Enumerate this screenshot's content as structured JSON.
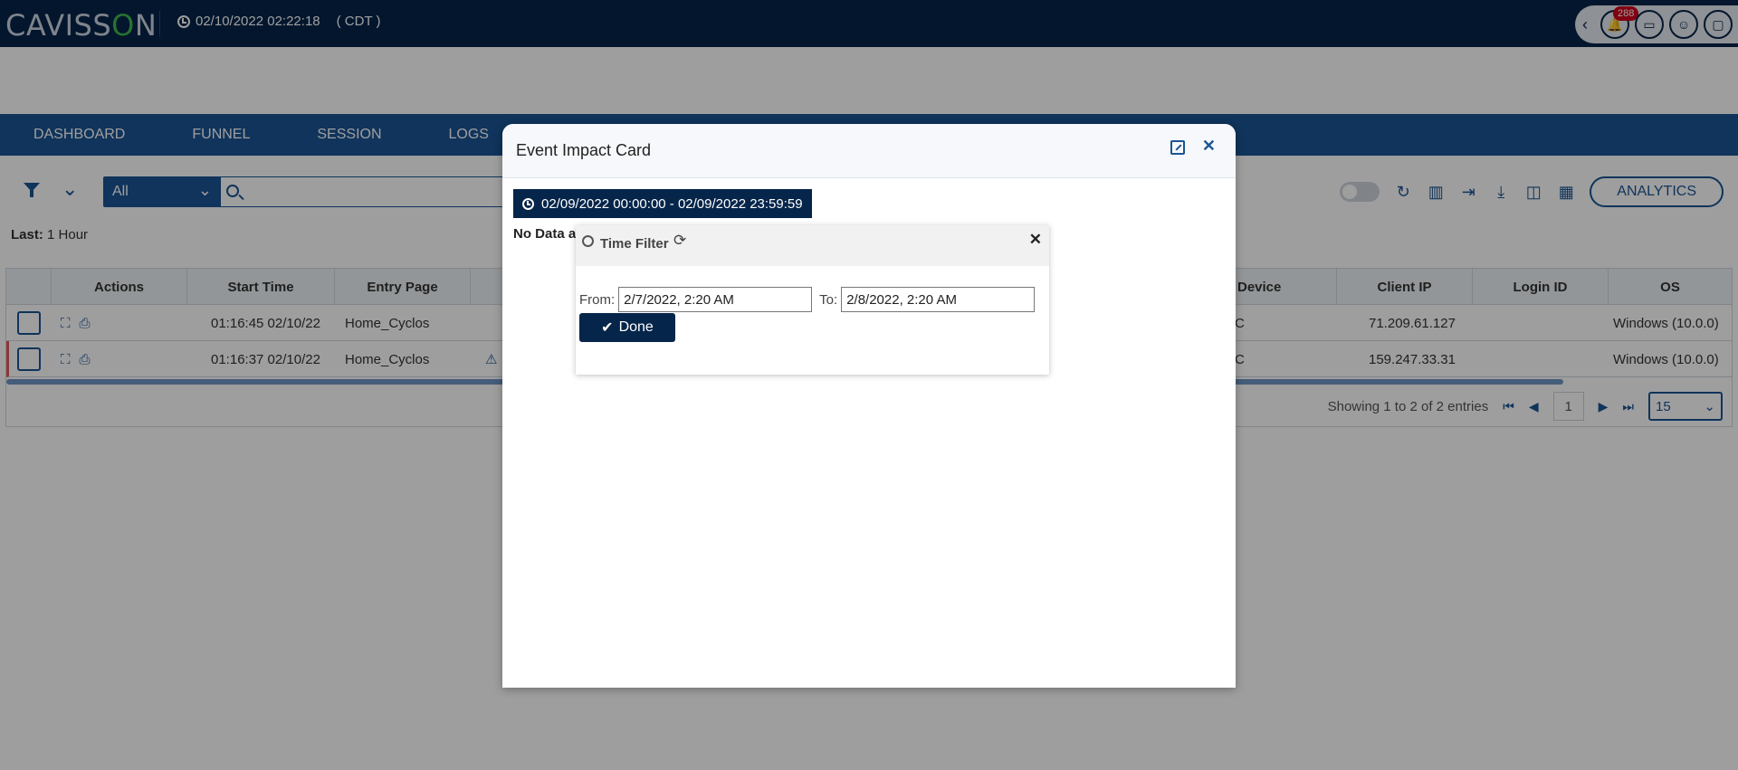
{
  "header": {
    "logo_prefix": "CAVISS",
    "logo_o": "O",
    "logo_suffix": "N",
    "datetime": "02/10/2022 02:22:18",
    "timezone": "( CDT )",
    "notification_count": "288"
  },
  "nav": {
    "items": [
      {
        "label": "DASHBOARD"
      },
      {
        "label": "FUNNEL"
      },
      {
        "label": "SESSION"
      },
      {
        "label": "LOGS"
      }
    ]
  },
  "toolbar": {
    "filter_select_value": "All",
    "search_placeholder": "",
    "analytics_label": "ANALYTICS"
  },
  "last_filter": {
    "label": "Last:",
    "value": "1 Hour"
  },
  "table": {
    "headers": {
      "actions": "Actions",
      "start_time": "Start Time",
      "entry_page": "Entry Page",
      "device": "Device",
      "client_ip": "Client IP",
      "login_id": "Login ID",
      "os": "OS"
    },
    "rows": [
      {
        "start_time": "01:16:45 02/10/22",
        "entry_page": "Home_Cyclos",
        "device": "C",
        "client_ip": "71.209.61.127",
        "login_id": "",
        "os": "Windows (10.0.0)"
      },
      {
        "start_time": "01:16:37 02/10/22",
        "entry_page": "Home_Cyclos",
        "device": "C",
        "client_ip": "159.247.33.31",
        "login_id": "",
        "os": "Windows (10.0.0)"
      }
    ],
    "pager": {
      "summary": "Showing 1 to 2 of 2 entries",
      "current_page": "1",
      "page_size": "15"
    }
  },
  "modal": {
    "title": "Event Impact Card",
    "date_range": "02/09/2022 00:00:00 - 02/09/2022 23:59:59",
    "no_data_text": "No Data a"
  },
  "time_filter": {
    "title": "Time Filter",
    "from_label": "From:",
    "from_value": "2/7/2022, 2:20 AM",
    "to_label": "To:",
    "to_value": "2/8/2022, 2:20 AM",
    "done_label": "Done"
  },
  "colors": {
    "header_bg": "#06254a",
    "nav_bg": "#1a5593",
    "accent": "#1a5593",
    "badge": "#d0021b"
  }
}
